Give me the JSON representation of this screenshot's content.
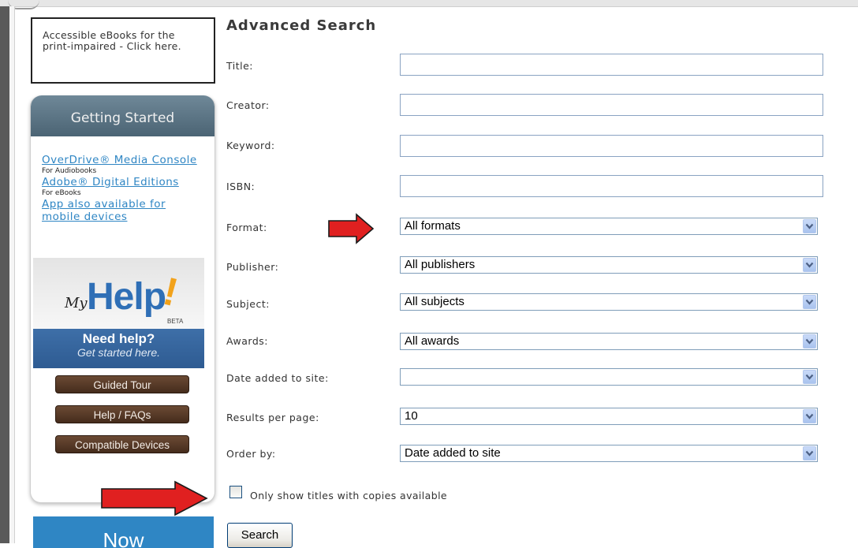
{
  "sidebar": {
    "accessible_text": "Accessible eBooks for the print-impaired - Click here.",
    "getting_started": {
      "title": "Getting Started",
      "links": [
        {
          "label": "OverDrive® Media Console",
          "note": "For Audiobooks"
        },
        {
          "label": "Adobe® Digital Editions",
          "note": "For eBooks"
        },
        {
          "label": "App also available for mobile devices",
          "note": ""
        }
      ]
    },
    "myhelp": {
      "my": "My",
      "help": "Help",
      "bang": "!",
      "beta": "BETA",
      "need_help": "Need help?",
      "get_started": "Get started here."
    },
    "buttons": {
      "guided_tour": "Guided Tour",
      "help_faqs": "Help / FAQs",
      "compatible_devices": "Compatible Devices"
    },
    "now_banner": "Now"
  },
  "form": {
    "title": "Advanced Search",
    "fields": {
      "title_label": "Title:",
      "title_value": "",
      "creator_label": "Creator:",
      "creator_value": "",
      "keyword_label": "Keyword:",
      "keyword_value": "",
      "isbn_label": "ISBN:",
      "isbn_value": "",
      "format_label": "Format:",
      "format_value": "All formats",
      "publisher_label": "Publisher:",
      "publisher_value": "All publishers",
      "subject_label": "Subject:",
      "subject_value": "All subjects",
      "awards_label": "Awards:",
      "awards_value": "All awards",
      "date_added_label": "Date added to site:",
      "date_added_value": "",
      "results_label": "Results per page:",
      "results_value": "10",
      "order_label": "Order by:",
      "order_value": "Date added to site"
    },
    "available_only_label": "Only show titles with copies available",
    "available_only_checked": false,
    "search_button": "Search"
  },
  "colors": {
    "link": "#2f86c4",
    "accent_blue": "#2f86c4",
    "header_slate": "#5b7585",
    "button_brown": "#5a3c28",
    "arrow_red": "#e02020"
  }
}
